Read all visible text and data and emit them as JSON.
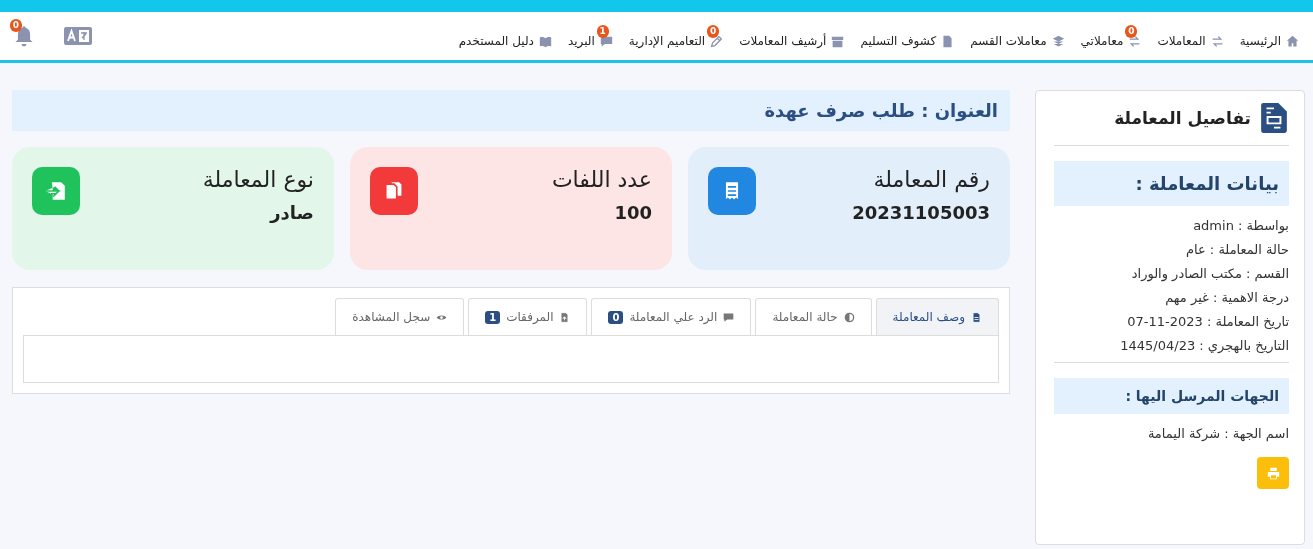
{
  "nav": {
    "items": [
      {
        "label": "الرئيسية"
      },
      {
        "label": "المعاملات"
      },
      {
        "label": "معاملاتي",
        "badge": "0"
      },
      {
        "label": "معاملات القسم"
      },
      {
        "label": "كشوف التسليم"
      },
      {
        "label": "أرشيف المعاملات"
      },
      {
        "label": "التعاميم الإدارية",
        "badge": "0"
      },
      {
        "label": "البريد",
        "badge": "1"
      },
      {
        "label": "دليل المستخدم"
      }
    ],
    "notifications_badge": "0"
  },
  "title": "العنوان : طلب صرف عهدة",
  "cards": [
    {
      "label": "رقم المعاملة",
      "value": "20231105003",
      "color": "#2187e0"
    },
    {
      "label": "عدد اللفات",
      "value": "100",
      "color": "#f23a3a"
    },
    {
      "label": "نوع المعاملة",
      "value": "صادر",
      "color": "#1fc25b"
    }
  ],
  "tabs": [
    {
      "label": "وصف المعاملة",
      "selected": true
    },
    {
      "label": "حالة المعاملة",
      "selected": false
    },
    {
      "label": "الرد علي المعاملة",
      "badge": "0",
      "selected": false
    },
    {
      "label": "المرفقات",
      "badge": "1",
      "selected": false
    },
    {
      "label": "سجل المشاهدة",
      "selected": false
    }
  ],
  "details": {
    "title": "تفاصيل المعاملة",
    "section_title": "بيانات المعاملة :",
    "lines": [
      "بواسطة : admin",
      "حالة المعاملة : عام",
      "القسم : مكتب الصادر والوراد",
      "درجة الاهمية : غير مهم",
      "تاريخ المعاملة : 2023-11-07",
      "التاريخ بالهجري : 1445/04/23"
    ],
    "recipients_title": "الجهات المرسل اليها :",
    "recipients": [
      "اسم الجهة : شركة اليمامة"
    ]
  }
}
